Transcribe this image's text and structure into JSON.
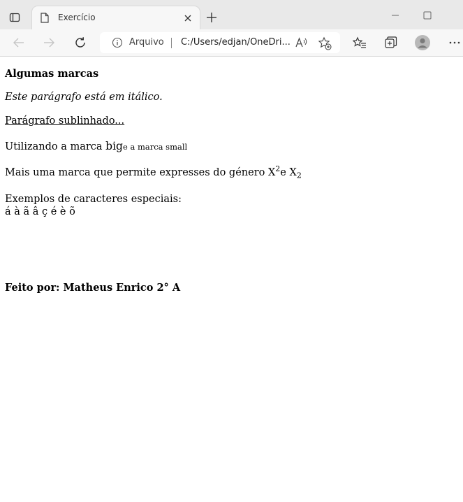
{
  "window": {
    "tab_title": "Exercício"
  },
  "toolbar": {
    "address_label": "Arquivo",
    "address_url": "C:/Users/edjan/OneDri...",
    "read_aloud_glyph": "A⁾"
  },
  "page": {
    "heading": "Algumas marcas",
    "italic_paragraph": "Este parágrafo está em itálico.",
    "underlined_paragraph": "Parágrafo sublinhado...",
    "bigsmall": {
      "prefix": "Utilizando a marca ",
      "big": "big",
      "small": "e a marca small"
    },
    "subsup": {
      "prefix": "Mais uma marca que permite expresses do género X",
      "sup": "2",
      "middle": "e X",
      "sub": "2"
    },
    "examples": {
      "label": "Exemplos de caracteres especiais:",
      "chars": "á à ã â ç é è õ"
    },
    "author": "Feito por: Matheus Enrico 2° A"
  },
  "colors": {
    "titlebar_bg": "#e9e9e9",
    "toolbar_bg": "#f7f7f7",
    "page_bg": "#ffffff",
    "icon_color": "#333333"
  },
  "icons": [
    "tab-actions-icon",
    "page-icon",
    "close-icon",
    "plus-icon",
    "minimize-icon",
    "maximize-icon",
    "back-arrow-icon",
    "forward-arrow-icon",
    "reload-icon",
    "info-icon",
    "read-aloud-icon",
    "add-favorite-icon",
    "favorites-icon",
    "collections-icon",
    "profile-icon",
    "more-icon"
  ]
}
